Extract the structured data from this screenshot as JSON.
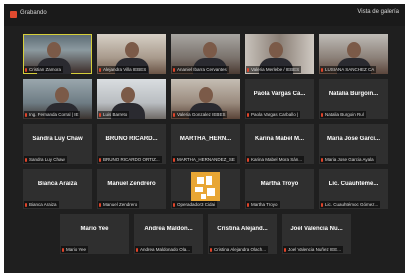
{
  "window": {
    "title": "Grabando",
    "layout_button": "Vista de galería"
  },
  "tiles": [
    {
      "type": "video",
      "label": "Cristian Zamora",
      "active": true
    },
    {
      "type": "video",
      "label": "Alejandra Villa IEBES"
    },
    {
      "type": "video",
      "label": "Ananiel Ibarra Cervantes"
    },
    {
      "type": "video",
      "label": "Valeria Merlebe / IEBES"
    },
    {
      "type": "video",
      "label": "LUSIANA SANCHEZ CA"
    },
    {
      "type": "video",
      "label": "Ing. Fernanda Corral | IE"
    },
    {
      "type": "video",
      "label": "Luis Barreto"
    },
    {
      "type": "video",
      "label": "Valeria Gonzalez IEBES"
    },
    {
      "type": "name",
      "name": "Paola Vargas Ca...",
      "label": "Paola Vargas Carballo |"
    },
    {
      "type": "name",
      "name": "Natalia Burgoin...",
      "label": "Natalia Burgoin Rul"
    },
    {
      "type": "name",
      "name": "Sandra Luy Chaw",
      "label": "Sandra Luy Chaw"
    },
    {
      "type": "name",
      "name": "BRUNO RICARD...",
      "label": "BRUNO RICARDO ORTIZ..."
    },
    {
      "type": "name",
      "name": "MARTHA_HERN...",
      "label": "MARTHA_HERNANDEZ_SE"
    },
    {
      "type": "name",
      "name": "Karina Mabel M...",
      "label": "Karina Mabel Mora Sán..."
    },
    {
      "type": "name",
      "name": "Maria Jose Garci...",
      "label": "Maria Jose Garcia Ayala"
    },
    {
      "type": "name",
      "name": "Bianca Araiza",
      "label": "Bianca Araiza"
    },
    {
      "type": "name",
      "name": "Manuel Zendrero",
      "label": "Manuel Zendrero"
    },
    {
      "type": "avatar",
      "label": "Operadador3 Cidai"
    },
    {
      "type": "name",
      "name": "Martha Troyo",
      "label": "Martha Troyo"
    },
    {
      "type": "name",
      "name": "Lic. Cuauhtéme...",
      "label": "Lic. Cuauhtémoc Gómez..."
    },
    {
      "type": "name",
      "name": "Mario Yee",
      "label": "Mario Yee"
    },
    {
      "type": "name",
      "name": "Andrea Maldon...",
      "label": "Andrea Maldonado Ola..."
    },
    {
      "type": "name",
      "name": "Cristina Alejand...",
      "label": "Cristina Alejandra Olach..."
    },
    {
      "type": "name",
      "name": "Joel Valencia Nu...",
      "label": "Joel Valencia Nuñez IEE..."
    }
  ]
}
